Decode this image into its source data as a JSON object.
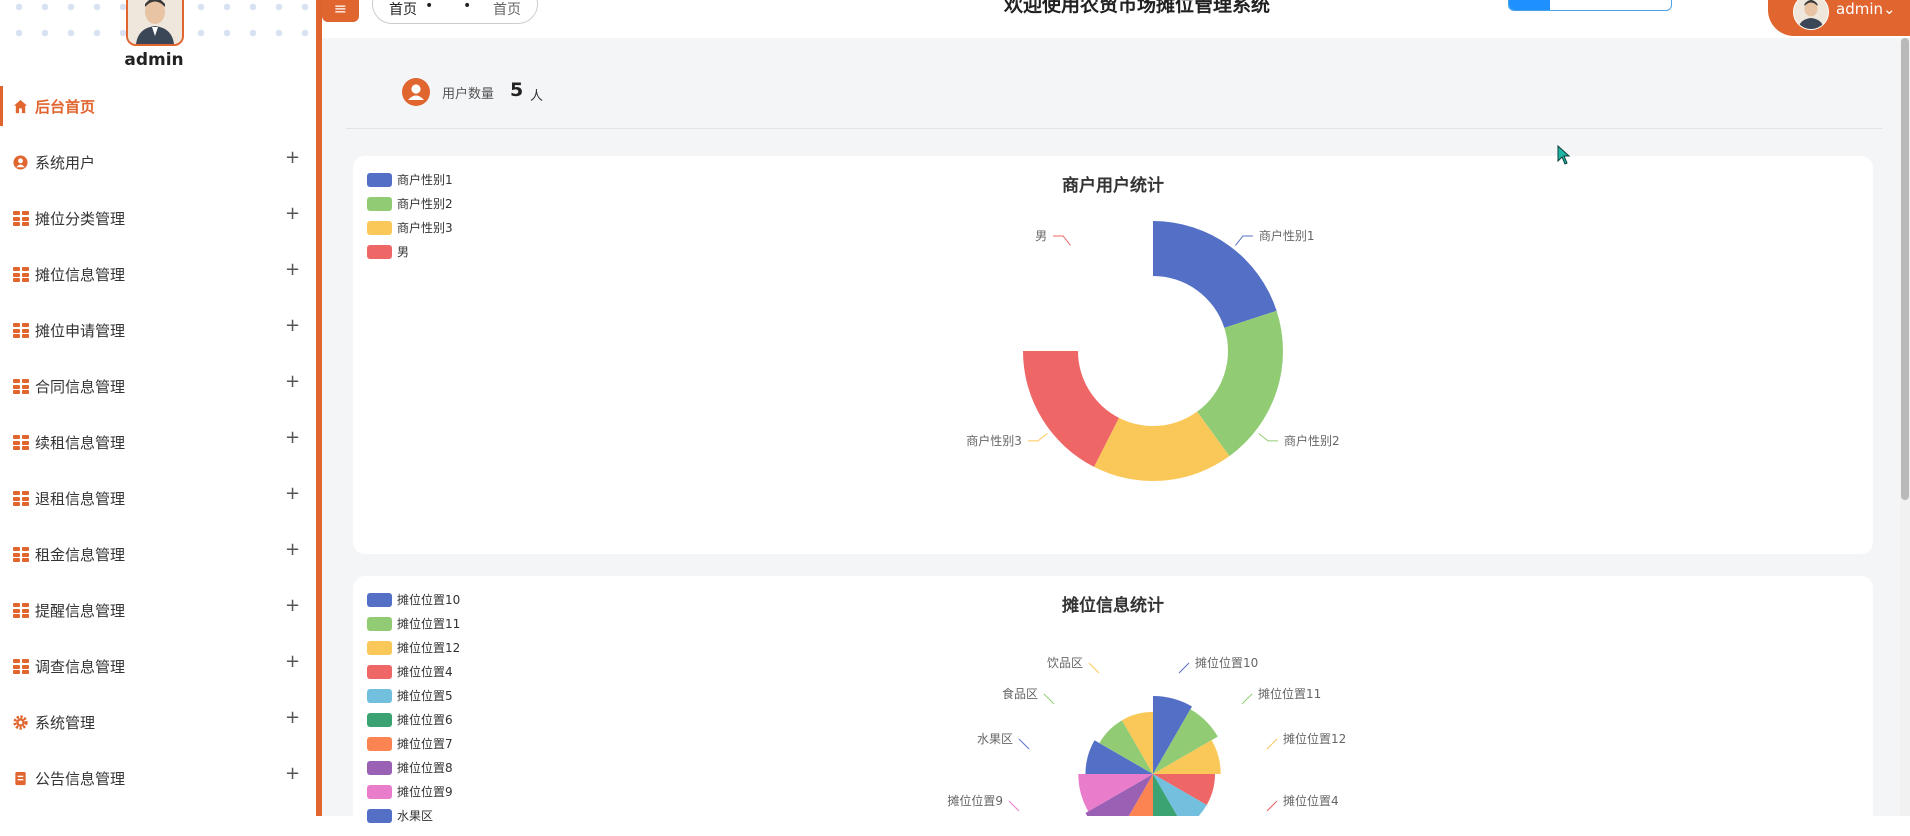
{
  "sidebar": {
    "username": "admin",
    "items": [
      {
        "label": "后台首页",
        "icon": "home-icon",
        "active": true,
        "expandable": false
      },
      {
        "label": "系统用户",
        "icon": "user-icon",
        "active": false,
        "expandable": true
      },
      {
        "label": "摊位分类管理",
        "icon": "grid-icon",
        "active": false,
        "expandable": true
      },
      {
        "label": "摊位信息管理",
        "icon": "grid-icon",
        "active": false,
        "expandable": true
      },
      {
        "label": "摊位申请管理",
        "icon": "grid-icon",
        "active": false,
        "expandable": true
      },
      {
        "label": "合同信息管理",
        "icon": "grid-icon",
        "active": false,
        "expandable": true
      },
      {
        "label": "续租信息管理",
        "icon": "grid-icon",
        "active": false,
        "expandable": true
      },
      {
        "label": "退租信息管理",
        "icon": "grid-icon",
        "active": false,
        "expandable": true
      },
      {
        "label": "租金信息管理",
        "icon": "grid-icon",
        "active": false,
        "expandable": true
      },
      {
        "label": "提醒信息管理",
        "icon": "grid-icon",
        "active": false,
        "expandable": true
      },
      {
        "label": "调查信息管理",
        "icon": "grid-icon",
        "active": false,
        "expandable": true
      },
      {
        "label": "系统管理",
        "icon": "gear-icon",
        "active": false,
        "expandable": true
      },
      {
        "label": "公告信息管理",
        "icon": "document-icon",
        "active": false,
        "expandable": true
      }
    ],
    "expand_symbol": "+"
  },
  "header": {
    "menu_toggle": "≡",
    "breadcrumb": [
      "首页",
      "•",
      "•",
      "首页"
    ],
    "title": "欢迎使用农贸市场摊位管理系统",
    "progress": 0.25,
    "user_name": "admin",
    "user_caret": "⌄"
  },
  "stats": {
    "user_count_label": "用户数量",
    "user_count_value": "5",
    "user_count_unit": "人"
  },
  "colors": {
    "accent": "#e0652f",
    "palette": [
      "#5470c6",
      "#91cc75",
      "#fac858",
      "#ee6666",
      "#73c0de",
      "#3ba272",
      "#fc8452",
      "#9a60b4",
      "#ea7ccc"
    ]
  },
  "chart_data": [
    {
      "type": "pie",
      "variant": "donut",
      "title": "商户用户统计",
      "legend_position": "top-left",
      "series": [
        {
          "name": "商户性别1",
          "value": 1,
          "color": "#5470c6"
        },
        {
          "name": "商户性别2",
          "value": 1,
          "color": "#91cc75"
        },
        {
          "name": "商户性别3",
          "value": 1,
          "color": "#fac858"
        },
        {
          "name": "男",
          "value": 0,
          "color": "#ee6666"
        }
      ],
      "slice_fractions": [
        0.2,
        0.2,
        0.175,
        0.175
      ],
      "label_names": [
        "商户性别1",
        "商户性别2",
        "商户性别3",
        "男"
      ]
    },
    {
      "type": "pie",
      "variant": "rose",
      "title": "摊位信息统计",
      "legend_position": "top-left",
      "legend": [
        {
          "name": "摊位位置10",
          "color": "#5470c6"
        },
        {
          "name": "摊位位置11",
          "color": "#91cc75"
        },
        {
          "name": "摊位位置12",
          "color": "#fac858"
        },
        {
          "name": "摊位位置4",
          "color": "#ee6666"
        },
        {
          "name": "摊位位置5",
          "color": "#73c0de"
        },
        {
          "name": "摊位位置6",
          "color": "#3ba272"
        },
        {
          "name": "摊位位置7",
          "color": "#fc8452"
        },
        {
          "name": "摊位位置8",
          "color": "#9a60b4"
        },
        {
          "name": "摊位位置9",
          "color": "#ea7ccc"
        },
        {
          "name": "水果区",
          "color": "#5470c6"
        }
      ],
      "slices": [
        {
          "name": "摊位位置10",
          "color": "#5470c6",
          "radius": 1.0
        },
        {
          "name": "摊位位置11",
          "color": "#91cc75",
          "radius": 1.0
        },
        {
          "name": "摊位位置12",
          "color": "#fac858",
          "radius": 1.0
        },
        {
          "name": "摊位位置4",
          "color": "#ee6666",
          "radius": 1.0
        },
        {
          "name": "摊位位置5",
          "color": "#73c0de",
          "radius": 1.0
        },
        {
          "name": "摊位位置6",
          "color": "#3ba272",
          "radius": 1.0
        },
        {
          "name": "摊位位置7",
          "color": "#fc8452",
          "radius": 1.0
        },
        {
          "name": "摊位位置8",
          "color": "#9a60b4",
          "radius": 1.0
        },
        {
          "name": "摊位位置9",
          "color": "#ea7ccc",
          "radius": 1.0
        },
        {
          "name": "水果区",
          "color": "#5470c6",
          "radius": 1.0
        },
        {
          "name": "食品区",
          "color": "#91cc75",
          "radius": 1.0
        },
        {
          "name": "饮品区",
          "color": "#fac858",
          "radius": 1.0
        }
      ],
      "visible_labels": [
        "摊位位置10",
        "摊位位置11",
        "摊位位置12",
        "摊位位置4",
        "饮品区",
        "食品区",
        "水果区",
        "摊位位置9"
      ]
    }
  ]
}
